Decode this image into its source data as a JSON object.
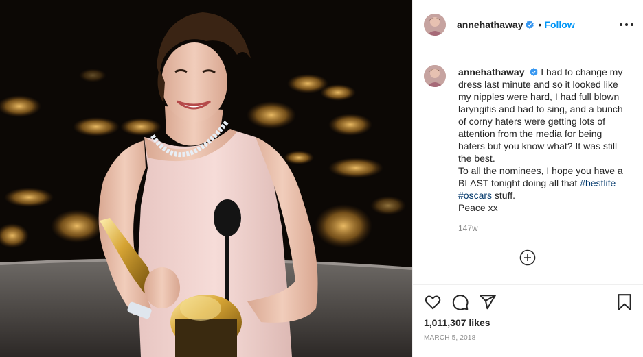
{
  "post": {
    "username": "annehathaway",
    "follow_label": "Follow",
    "separator": "•",
    "caption": {
      "line1": "I had to change my dress last minute and so it looked like my nipples were hard, I had full blown laryngitis and had to sing, and a bunch of corny haters were getting lots of attention from the media for being haters but you know what? It was still the best.",
      "line2_text": "To all the nominees, I hope you have a BLAST tonight doing all that",
      "hashtag1": "#bestlife",
      "hashtag2": "#oscars",
      "line2_end": "stuff.",
      "line3": "Peace xx"
    },
    "age": "147w",
    "likes": "1,011,307 likes",
    "date": "MARCH 5, 2018"
  },
  "icons": [
    "verified-badge-icon",
    "more-options-icon",
    "add-comment-icon",
    "heart-icon",
    "comment-icon",
    "share-icon",
    "bookmark-icon"
  ],
  "colors": {
    "link": "#0095f6",
    "hashtag": "#00376b",
    "muted": "#8e8e8e",
    "text": "#262626",
    "verified": "#3897f0"
  }
}
